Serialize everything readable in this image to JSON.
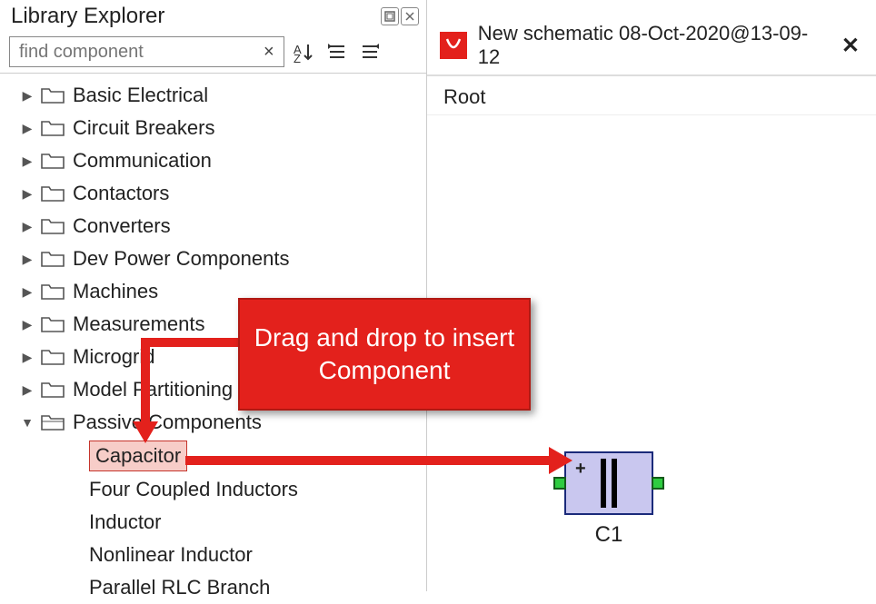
{
  "library": {
    "title": "Library Explorer",
    "search_placeholder": "find component",
    "categories": [
      {
        "label": "Basic Electrical",
        "expanded": false
      },
      {
        "label": "Circuit Breakers",
        "expanded": false
      },
      {
        "label": "Communication",
        "expanded": false
      },
      {
        "label": "Contactors",
        "expanded": false
      },
      {
        "label": "Converters",
        "expanded": false
      },
      {
        "label": "Dev Power Components",
        "expanded": false
      },
      {
        "label": "Machines",
        "expanded": false
      },
      {
        "label": "Measurements",
        "expanded": false
      },
      {
        "label": "Microgrid",
        "expanded": false
      },
      {
        "label": "Model Partitioning",
        "expanded": false
      },
      {
        "label": "Passive Components",
        "expanded": true
      }
    ],
    "passive_items": [
      "Capacitor",
      "Four Coupled Inductors",
      "Inductor",
      "Nonlinear Inductor",
      "Parallel RLC Branch"
    ],
    "selected_item": "Capacitor"
  },
  "schematic": {
    "tab_title": "New schematic 08-Oct-2020@13-09-12",
    "breadcrumb": "Root",
    "component_label": "C1"
  },
  "annotation": {
    "text": "Drag and drop to insert Component",
    "color": "#e3211c"
  }
}
